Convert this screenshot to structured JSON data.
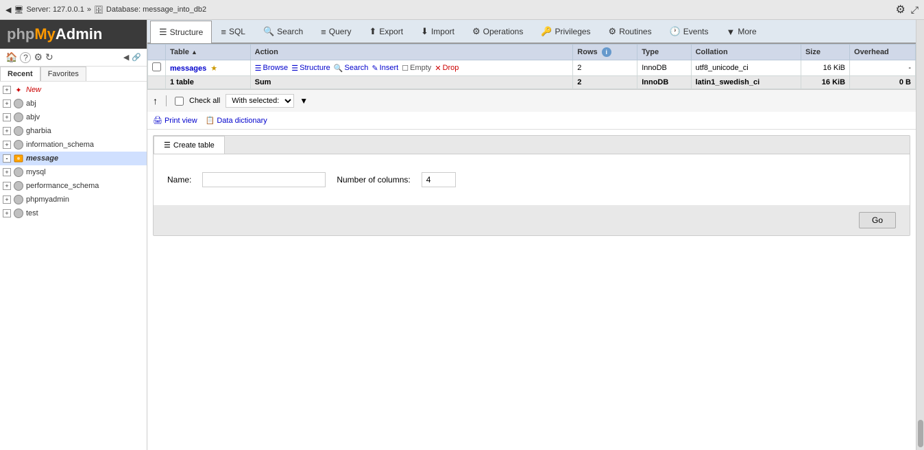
{
  "logo": {
    "php": "php",
    "my": "My",
    "admin": "Admin"
  },
  "topbar": {
    "back_icon": "◀",
    "forward_icon": "▶",
    "server": "Server: 127.0.0.1",
    "database": "Database: message_into_db2",
    "gear_icon": "⚙",
    "expand_icon": "⤢"
  },
  "sidebar": {
    "recent_label": "Recent",
    "favorites_label": "Favorites",
    "new_label": "New",
    "databases": [
      {
        "name": "abj",
        "active": false
      },
      {
        "name": "abjv",
        "active": false
      },
      {
        "name": "gharbia",
        "active": false
      },
      {
        "name": "information_schema",
        "active": false
      },
      {
        "name": "message",
        "active": true
      },
      {
        "name": "mysql",
        "active": false
      },
      {
        "name": "performance_schema",
        "active": false
      },
      {
        "name": "phpmyadmin",
        "active": false
      },
      {
        "name": "test",
        "active": false
      }
    ],
    "icons": {
      "home": "🏠",
      "help": "?",
      "settings": "⚙",
      "refresh": "↻",
      "collapse": "◀",
      "expand": "▶"
    }
  },
  "tabs": [
    {
      "id": "structure",
      "label": "Structure",
      "icon": "☰",
      "active": true
    },
    {
      "id": "sql",
      "label": "SQL",
      "icon": "≡"
    },
    {
      "id": "search",
      "label": "Search",
      "icon": "🔍"
    },
    {
      "id": "query",
      "label": "Query",
      "icon": "≡"
    },
    {
      "id": "export",
      "label": "Export",
      "icon": "⬆"
    },
    {
      "id": "import",
      "label": "Import",
      "icon": "⬇"
    },
    {
      "id": "operations",
      "label": "Operations",
      "icon": "⚙"
    },
    {
      "id": "privileges",
      "label": "Privileges",
      "icon": "🔑"
    },
    {
      "id": "routines",
      "label": "Routines",
      "icon": "⚙"
    },
    {
      "id": "events",
      "label": "Events",
      "icon": "🕐"
    },
    {
      "id": "more",
      "label": "More",
      "icon": "▼"
    }
  ],
  "table": {
    "columns": [
      "Table",
      "Action",
      "Rows",
      "",
      "Type",
      "Collation",
      "Size",
      "Overhead"
    ],
    "rows": [
      {
        "name": "messages",
        "starred": true,
        "actions": [
          "Browse",
          "Structure",
          "Search",
          "Insert",
          "Empty",
          "Drop"
        ],
        "rows": "2",
        "type": "InnoDB",
        "collation": "utf8_unicode_ci",
        "size": "16 KiB",
        "overhead": "-"
      }
    ],
    "sum_row": {
      "label": "1 table",
      "sum": "Sum",
      "rows": "2",
      "type": "InnoDB",
      "collation": "latin1_swedish_ci",
      "size": "16 KiB",
      "overhead": "0 B"
    }
  },
  "bottom_toolbar": {
    "check_all_label": "Check all",
    "with_selected_label": "With selected:",
    "with_selected_placeholder": "With selected:",
    "with_selected_options": [
      "With selected:"
    ]
  },
  "print_links": {
    "print_view": "Print view",
    "data_dictionary": "Data dictionary"
  },
  "create_table": {
    "tab_label": "Create table",
    "name_label": "Name:",
    "name_placeholder": "",
    "cols_label": "Number of columns:",
    "cols_value": "4",
    "go_button": "Go"
  }
}
